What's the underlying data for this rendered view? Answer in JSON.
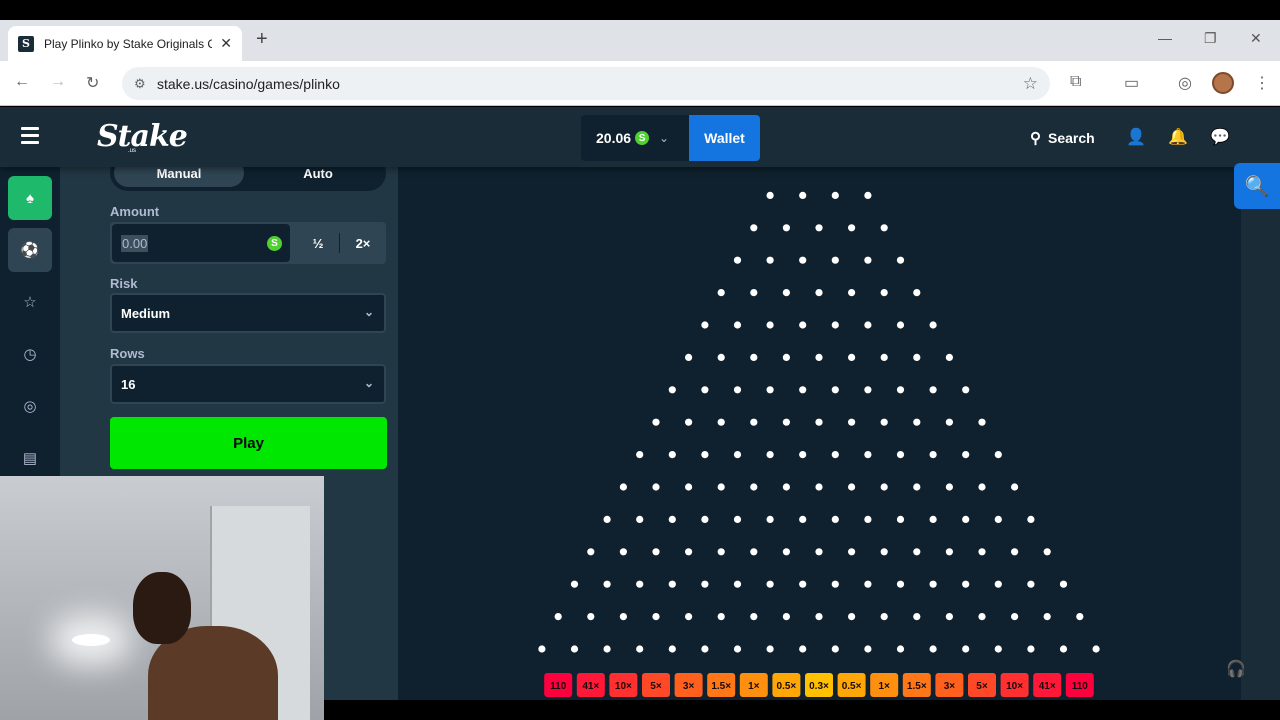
{
  "browser": {
    "tab_title": "Play Plinko by Stake Originals C",
    "url": "stake.us/casino/games/plinko"
  },
  "header": {
    "balance": "20.06",
    "currency_symbol": "S",
    "wallet_label": "Wallet",
    "search_label": "Search"
  },
  "panel": {
    "mode_manual": "Manual",
    "mode_auto": "Auto",
    "amount_label": "Amount",
    "amount_value": "0.00",
    "half_label": "½",
    "double_label": "2×",
    "risk_label": "Risk",
    "risk_value": "Medium",
    "rows_label": "Rows",
    "rows_value": "16",
    "play_label": "Play"
  },
  "game": {
    "rows": 16,
    "multipliers": [
      "110",
      "41×",
      "10×",
      "5×",
      "3×",
      "1.5×",
      "1×",
      "0.5×",
      "0.3×",
      "0.5×",
      "1×",
      "1.5×",
      "3×",
      "5×",
      "10×",
      "41×",
      "110"
    ],
    "multiplier_colors": [
      "#ff003f",
      "#ff1837",
      "#ff302f",
      "#ff4827",
      "#ff601e",
      "#ff7716",
      "#ff8f0e",
      "#ffa706",
      "#ffc000",
      "#ffa706",
      "#ff8f0e",
      "#ff7716",
      "#ff601e",
      "#ff4827",
      "#ff302f",
      "#ff1837",
      "#ff003f"
    ]
  },
  "colors": {
    "bg_dark": "#0f212e",
    "bg_main": "#1a2c38",
    "panel": "#213743",
    "play_green": "#00e701",
    "wallet_blue": "#1475e1"
  }
}
